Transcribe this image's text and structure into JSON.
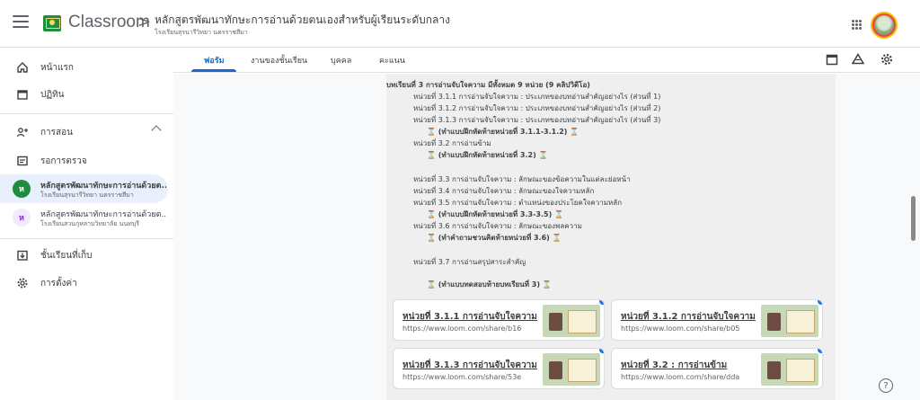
{
  "header": {
    "app_name": "Classroom",
    "breadcrumb_separator": ">",
    "course_title": "หลักสูตรพัฒนาทักษะการอ่านด้วยตนเองสำหรับผู้เรียนระดับกลาง",
    "course_subtitle": "โรงเรียนสุรนารีวิทยา นครราชสีมา"
  },
  "sidebar": {
    "items": [
      {
        "label": "หน้าแรก",
        "icon": "home-icon"
      },
      {
        "label": "ปฏิทิน",
        "icon": "calendar-icon"
      },
      {
        "label": "การสอน",
        "icon": "teaching-icon"
      },
      {
        "label": "รอการตรวจ",
        "icon": "review-icon"
      },
      {
        "label": "ชั้นเรียนที่เก็บ",
        "icon": "archive-icon"
      },
      {
        "label": "การตั้งค่า",
        "icon": "settings-icon"
      }
    ],
    "classes": [
      {
        "badge": "ห",
        "title": "หลักสูตรพัฒนาทักษะการอ่านด้วยต...",
        "subtitle": "โรงเรียนสุรนารีวิทยา นครราชสีมา"
      },
      {
        "badge": "ห",
        "title": "หลักสูตรพัฒนาทักษะการอ่านด้วยต...",
        "subtitle": "โรงเรียนสวนกุหลาบวิทยาลัย นนทบุรี"
      }
    ]
  },
  "tabs": [
    "ฟอรัม",
    "งานของชั้นเรียน",
    "บุคคล",
    "คะแนน"
  ],
  "document": {
    "heading": "บทเรียนที่ 3 การอ่านจับใจความ มีทั้งหมด 9 หน่วย (9 คลิปวิดีโอ)",
    "lines": [
      "หน่วยที่ 3.1.1 การอ่านจับใจความ : ประเภทของบทอ่านสำคัญอย่างไร (ส่วนที่ 1)",
      "หน่วยที่ 3.1.2 การอ่านจับใจความ : ประเภทของบทอ่านสำคัญอย่างไร (ส่วนที่ 2)",
      "หน่วยที่ 3.1.3 การอ่านจับใจความ : ประเภทของบทอ่านสำคัญอย่างไร (ส่วนที่ 3)",
      "(ทำแบบฝึกหัดท้ายหน่วยที่ 3.1.1-3.1.2)",
      "หน่วยที่ 3.2  การอ่านข้าม",
      "(ทำแบบฝึกหัดท้ายหน่วยที่ 3.2)",
      "หน่วยที่ 3.3  การอ่านจับใจความ : ลักษณะของข้อความในแต่ละย่อหน้า",
      "หน่วยที่ 3.4  การอ่านจับใจความ : ลักษณะของใจความหลัก",
      "หน่วยที่ 3.5  การอ่านจับใจความ : ตำแหน่งของประโยคใจความหลัก",
      "(ทำแบบฝึกหัดท้ายหน่วยที่ 3.3-3.5)",
      "หน่วยที่ 3.6  การอ่านจับใจความ : ลักษณะของพลความ",
      "(ทำคำถามชวนคิดท้ายหน่วยที่ 3.6)",
      "หน่วยที่ 3.7  การอ่านสรุปสาระสำคัญ",
      "(ทำแบบทดสอบท้ายบทเรียนที่ 3)"
    ],
    "hourglass": "⌛"
  },
  "cards": [
    {
      "title": "หน่วยที่ 3.1.1 การอ่านจับใจความ...",
      "url": "https://www.loom.com/share/b16"
    },
    {
      "title": "หน่วยที่ 3.1.2 การอ่านจับใจความ...",
      "url": "https://www.loom.com/share/b05"
    },
    {
      "title": "หน่วยที่ 3.1.3 การอ่านจับใจความ...",
      "url": "https://www.loom.com/share/53e"
    },
    {
      "title": "หน่วยที่ 3.2 : การอ่านข้าม",
      "url": "https://www.loom.com/share/dda"
    }
  ],
  "help_label": "?"
}
